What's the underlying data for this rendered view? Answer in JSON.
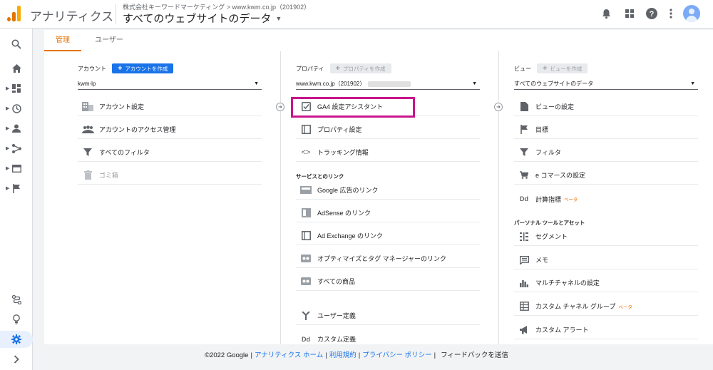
{
  "header": {
    "app_name": "アナリティクス",
    "account_path": "株式会社キーワードマーケティング > www.kwm.co.jp（201902）",
    "view_title": "すべてのウェブサイトのデータ",
    "icons": [
      "bell-icon",
      "apps-icon",
      "help-icon",
      "more-vert-icon",
      "account-avatar"
    ]
  },
  "leftnav": {
    "items": [
      "search-icon",
      "home-icon",
      "customization-icon",
      "realtime-icon",
      "audience-icon",
      "acquisition-icon",
      "behavior-icon",
      "conversions-icon",
      "attribution-icon",
      "discover-icon",
      "admin-icon",
      "expand-icon"
    ]
  },
  "tabs": [
    "管理",
    "ユーザー"
  ],
  "account": {
    "heading": "アカウント",
    "create_label": "アカウントを作成",
    "selected": "kwm-lp",
    "items": [
      "アカウント設定",
      "アカウントのアクセス管理",
      "すべてのフィルタ",
      "ゴミ箱"
    ]
  },
  "property": {
    "heading": "プロパティ",
    "create_label": "プロパティを作成",
    "selected": "www.kwm.co.jp（201902）",
    "items": [
      "GA4 設定アシスタント",
      "プロパティ設定",
      "トラッキング情報"
    ],
    "section_links": "サービスとのリンク",
    "links": [
      "Google 広告のリンク",
      "AdSense のリンク",
      "Ad Exchange のリンク",
      "オプティマイズとタグ マネージャーのリンク",
      "すべての商品"
    ],
    "more": [
      "ユーザー定義",
      "カスタム定義"
    ]
  },
  "view": {
    "heading": "ビュー",
    "create_label": "ビューを作成",
    "selected": "すべてのウェブサイトのデータ",
    "items": [
      "ビューの設定",
      "目標",
      "フィルタ",
      "e コマースの設定",
      "計算指標"
    ],
    "beta": "ベータ",
    "section_personal": "パーソナル ツールとアセット",
    "personal": [
      "セグメント",
      "メモ",
      "マルチチャネルの設定",
      "カスタム チャネル グループ",
      "カスタム アラート"
    ]
  },
  "footer": {
    "copyright": "©2022 Google",
    "links": [
      "アナリティクス ホーム",
      "利用規約",
      "プライバシー ポリシー"
    ],
    "feedback": "フィードバックを送信"
  },
  "colors": {
    "accent": "#e37400",
    "primary": "#1a73e8",
    "highlight": "#c8168c"
  }
}
